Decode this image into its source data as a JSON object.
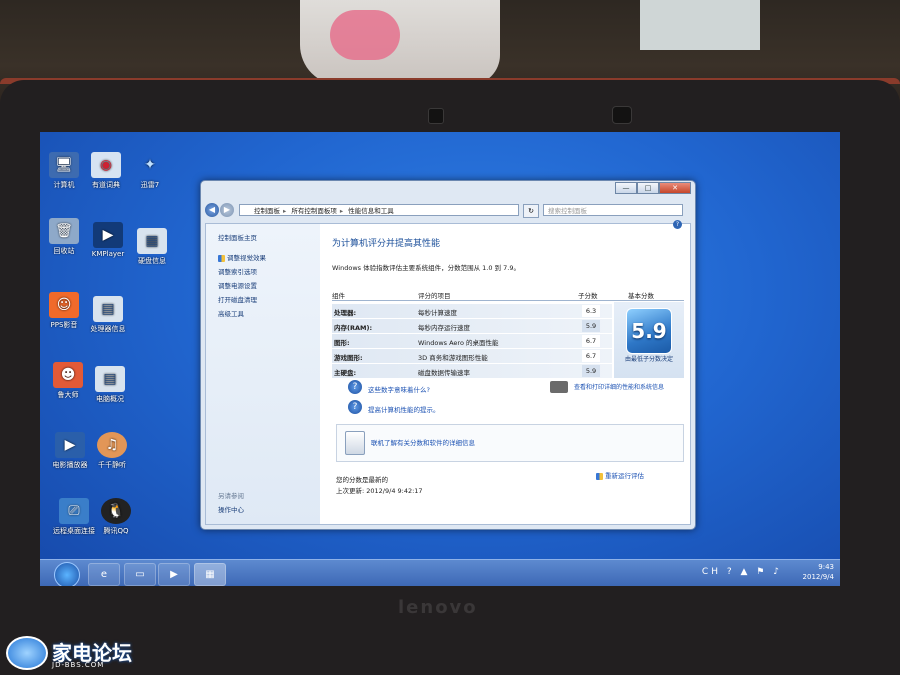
{
  "desktop": {
    "icons": [
      {
        "label": "计算机",
        "icon": "computer-icon"
      },
      {
        "label": "有道词典",
        "icon": "dictionary-icon"
      },
      {
        "label": "迅雷7",
        "icon": "thunder-icon"
      },
      {
        "label": "回收站",
        "icon": "recycle-bin-icon"
      },
      {
        "label": "KMPlayer",
        "icon": "kmplayer-icon"
      },
      {
        "label": "硬盘信息",
        "icon": "disk-info-icon"
      },
      {
        "label": "PPS影音",
        "icon": "pps-icon"
      },
      {
        "label": "处理器信息",
        "icon": "cpu-info-icon"
      },
      {
        "label": "鲁大师",
        "icon": "ludashi-icon"
      },
      {
        "label": "电脑概况",
        "icon": "pc-overview-icon"
      },
      {
        "label": "电影播放器",
        "icon": "media-player-icon"
      },
      {
        "label": "千千静听",
        "icon": "ttplayer-icon"
      },
      {
        "label": "远程桌面连接",
        "icon": "remote-desktop-icon"
      },
      {
        "label": "腾讯QQ",
        "icon": "qq-icon"
      }
    ]
  },
  "window": {
    "breadcrumb": [
      "控制面板",
      "所有控制面板项",
      "性能信息和工具"
    ],
    "search_placeholder": "搜索控制面板",
    "caption": {
      "minimize": "—",
      "maximize": "□",
      "close": "✕"
    },
    "left_nav": {
      "home": "控制面板主页",
      "items": [
        "调整视觉效果",
        "调整索引选项",
        "调整电源设置",
        "打开磁盘清理",
        "高级工具"
      ],
      "see_also": "另请参阅",
      "action_center": "操作中心"
    },
    "main": {
      "title": "为计算机评分并提高其性能",
      "subtitle": "Windows 体验指数评估主要系统组件，分数范围从 1.0 到 7.9。",
      "columns": {
        "component": "组件",
        "rated": "评分的项目",
        "subscore": "子分数",
        "base": "基本分数"
      },
      "rows": [
        {
          "component": "处理器:",
          "rated": "每秒计算速度",
          "subscore": "6.3"
        },
        {
          "component": "内存(RAM):",
          "rated": "每秒内存运行速度",
          "subscore": "5.9"
        },
        {
          "component": "图形:",
          "rated": "Windows Aero 的桌面性能",
          "subscore": "6.7"
        },
        {
          "component": "游戏图形:",
          "rated": "3D 商务和游戏图形性能",
          "subscore": "6.7"
        },
        {
          "component": "主硬盘:",
          "rated": "磁盘数据传输速率",
          "subscore": "5.9"
        }
      ],
      "base_score": "5.9",
      "base_caption": "由最低子分数决定",
      "links": {
        "what_mean": "这些数字意味着什么?",
        "tips": "提高计算机性能的提示。",
        "print": "查看和打印详细的性能和系统信息",
        "learn_more": "联机了解有关分数和软件的详细信息"
      },
      "status": "您的分数是最新的",
      "last_update": "上次更新: 2012/9/4 9:42:17",
      "rerun": "重新运行评估"
    }
  },
  "taskbar": {
    "time": "9:43",
    "date": "2012/9/4",
    "tray_icons": [
      "CH",
      "?",
      "▲",
      "⚑",
      "♪"
    ]
  },
  "hardware": {
    "brand": "lenovo"
  },
  "watermark": {
    "text": "家电论坛",
    "sub": "JD-BBS.COM"
  }
}
